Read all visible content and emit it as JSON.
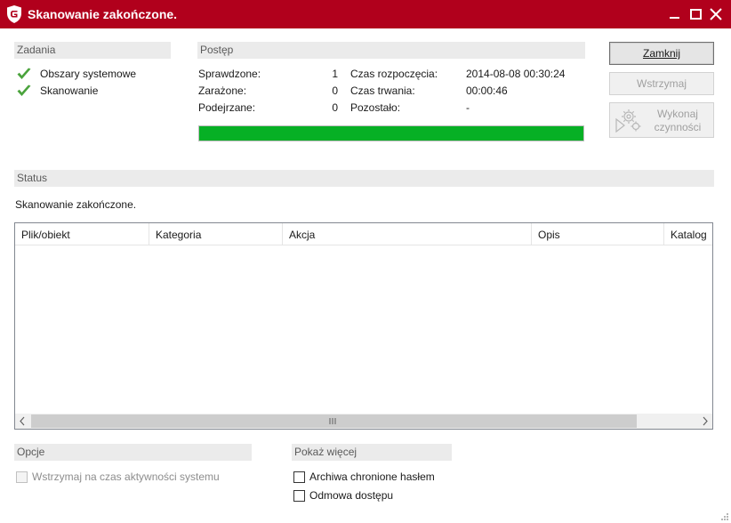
{
  "window": {
    "title": "Skanowanie zakończone.",
    "accent_color": "#b1001c",
    "icons": [
      "shield-logo-icon",
      "minimize-icon",
      "maximize-icon",
      "close-icon"
    ]
  },
  "tasks": {
    "header": "Zadania",
    "items": [
      {
        "label": "Obszary systemowe",
        "icon": "checkmark-icon"
      },
      {
        "label": "Skanowanie",
        "icon": "checkmark-icon"
      }
    ]
  },
  "progress": {
    "header": "Postęp",
    "checked_label": "Sprawdzone:",
    "checked_value": "1",
    "infected_label": "Zarażone:",
    "infected_value": "0",
    "suspicious_label": "Podejrzane:",
    "suspicious_value": "0",
    "start_label": "Czas rozpoczęcia:",
    "start_value": "2014-08-08 00:30:24",
    "duration_label": "Czas trwania:",
    "duration_value": "00:00:46",
    "remaining_label": "Pozostało:",
    "remaining_value": "-",
    "percent": 100,
    "bar_color": "#06b025"
  },
  "buttons": {
    "close": "Zamknij",
    "pause": "Wstrzymaj",
    "action_line1": "Wykonaj",
    "action_line2": "czynności"
  },
  "status": {
    "header": "Status",
    "text": "Skanowanie zakończone."
  },
  "results_table": {
    "columns": [
      "Plik/obiekt",
      "Kategoria",
      "Akcja",
      "Opis",
      "Katalog"
    ],
    "rows": []
  },
  "options": {
    "header": "Opcje",
    "pause_on_activity": "Wstrzymaj na czas aktywności systemu"
  },
  "show_more": {
    "header": "Pokaż więcej",
    "password_archives": "Archiwa chronione hasłem",
    "access_denied": "Odmowa dostępu"
  }
}
